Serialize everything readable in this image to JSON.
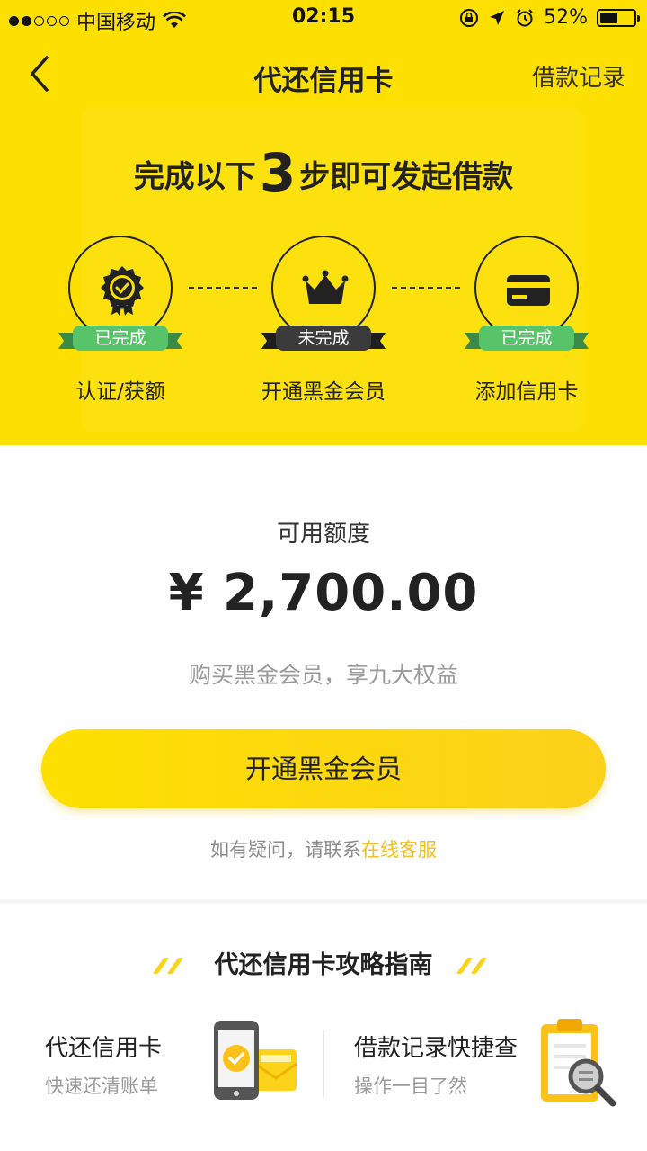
{
  "status_bar": {
    "carrier": "中国移动",
    "time": "02:15",
    "battery": "52%",
    "battery_level": 0.52
  },
  "nav": {
    "title": "代还信用卡",
    "right_link": "借款记录"
  },
  "headline": {
    "prefix": "完成以下",
    "number": "3",
    "suffix": "步即可发起借款"
  },
  "steps": [
    {
      "icon": "badge-check-icon",
      "status": "已完成",
      "state": "done",
      "label": "认证/获额"
    },
    {
      "icon": "crown-icon",
      "status": "未完成",
      "state": "todo",
      "label": "开通黑金会员"
    },
    {
      "icon": "card-icon",
      "status": "已完成",
      "state": "done",
      "label": "添加信用卡"
    }
  ],
  "main": {
    "limit_label": "可用额度",
    "amount": "¥ 2,700.00",
    "promo": "购买黑金会员，享九大权益",
    "cta_label": "开通黑金会员",
    "help_text": "如有疑问，请联系",
    "help_link": "在线客服"
  },
  "guide": {
    "title": "代还信用卡攻略指南",
    "items": [
      {
        "title": "代还信用卡",
        "subtitle": "快速还清账单",
        "icon": "phone-envelope-icon"
      },
      {
        "title": "借款记录快捷查",
        "subtitle": "操作一目了然",
        "icon": "clipboard-search-icon"
      }
    ]
  },
  "colors": {
    "brand_yellow": "#fde000",
    "done_green": "#57c46a",
    "todo_dark": "#3b3b3b",
    "link_yellow": "#f0c020"
  }
}
